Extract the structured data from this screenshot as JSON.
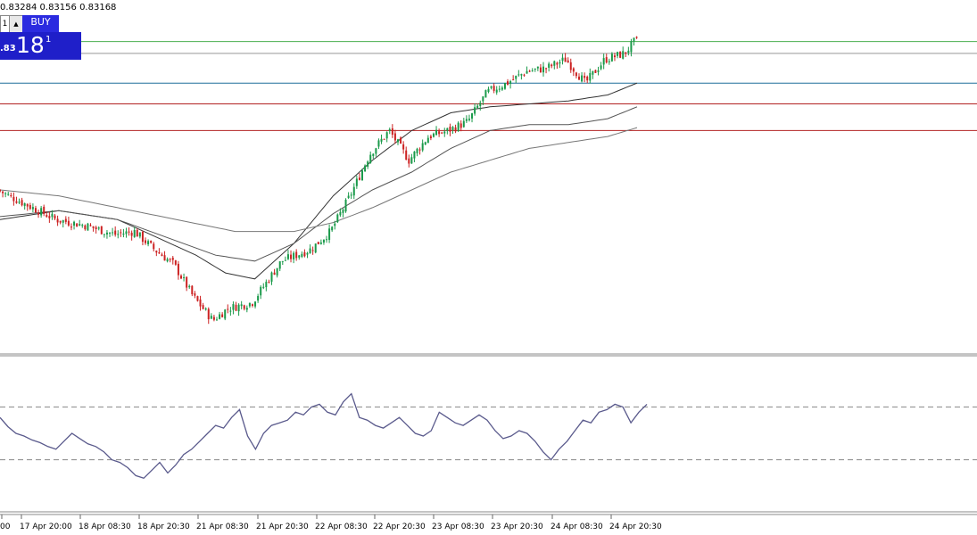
{
  "ohlc_header": "0.83284 0.83156 0.83168",
  "trade_panel": {
    "lot_value": "1",
    "up_arrow": "▲",
    "buy_label": "BUY",
    "price_small": ".83",
    "price_big": "18",
    "price_sup": "1"
  },
  "time_axis": {
    "labels": [
      "00",
      "17 Apr 20:00",
      "18 Apr 08:30",
      "18 Apr 20:30",
      "21 Apr 08:30",
      "21 Apr 20:30",
      "22 Apr 08:30",
      "22 Apr 20:30",
      "23 Apr 08:30",
      "23 Apr 20:30",
      "24 Apr 08:30",
      "24 Apr 20:30"
    ]
  },
  "colors": {
    "bull": "#1a9a4a",
    "bear": "#cc2222",
    "ma": "#444444",
    "oscillator": "#5a5a8c",
    "level_green": "#4caf50",
    "level_blue": "#1f6f9a",
    "level_red": "#b22222"
  },
  "chart_data": {
    "type": "candlestick",
    "symbol_quote": [
      "0.83284",
      "0.83156",
      "0.83168"
    ],
    "close_path": [
      [
        0,
        52
      ],
      [
        3,
        47
      ],
      [
        6,
        42
      ],
      [
        9,
        40
      ],
      [
        12,
        37
      ],
      [
        14,
        38
      ],
      [
        16,
        32
      ],
      [
        18,
        27
      ],
      [
        20,
        16
      ],
      [
        22,
        8
      ],
      [
        23.5,
        12
      ],
      [
        26,
        14
      ],
      [
        29,
        28
      ],
      [
        32,
        32
      ],
      [
        34,
        38
      ],
      [
        36,
        50
      ],
      [
        38,
        64
      ],
      [
        40,
        72
      ],
      [
        42,
        62
      ],
      [
        44,
        70
      ],
      [
        46,
        72
      ],
      [
        48,
        75
      ],
      [
        50,
        85
      ],
      [
        52,
        88
      ],
      [
        54,
        92
      ],
      [
        56,
        93
      ],
      [
        58,
        96
      ],
      [
        60,
        88
      ],
      [
        62,
        96
      ],
      [
        64,
        98
      ],
      [
        65,
        102
      ]
    ],
    "moving_averages": [
      {
        "path": [
          [
            0,
            42
          ],
          [
            6,
            45
          ],
          [
            12,
            42
          ],
          [
            16,
            36
          ],
          [
            20,
            30
          ],
          [
            23,
            24
          ],
          [
            26,
            22
          ],
          [
            30,
            34
          ],
          [
            34,
            50
          ],
          [
            38,
            62
          ],
          [
            42,
            72
          ],
          [
            46,
            78
          ],
          [
            50,
            80
          ],
          [
            54,
            81
          ],
          [
            58,
            82
          ],
          [
            62,
            84
          ],
          [
            65,
            88
          ]
        ]
      },
      {
        "path": [
          [
            0,
            43
          ],
          [
            6,
            45
          ],
          [
            12,
            42
          ],
          [
            17,
            36
          ],
          [
            22,
            30
          ],
          [
            26,
            28
          ],
          [
            30,
            34
          ],
          [
            34,
            44
          ],
          [
            38,
            52
          ],
          [
            42,
            58
          ],
          [
            46,
            66
          ],
          [
            50,
            72
          ],
          [
            54,
            74
          ],
          [
            58,
            74
          ],
          [
            62,
            76
          ],
          [
            65,
            80
          ]
        ]
      },
      {
        "path": [
          [
            0,
            52
          ],
          [
            6,
            50
          ],
          [
            12,
            46
          ],
          [
            18,
            42
          ],
          [
            24,
            38
          ],
          [
            30,
            38
          ],
          [
            34,
            41
          ],
          [
            38,
            46
          ],
          [
            42,
            52
          ],
          [
            46,
            58
          ],
          [
            50,
            62
          ],
          [
            54,
            66
          ],
          [
            58,
            68
          ],
          [
            62,
            70
          ],
          [
            65,
            73
          ]
        ]
      }
    ],
    "horizontal_levels": [
      {
        "value": 102,
        "color": "green"
      },
      {
        "value": 98,
        "color": "gray"
      },
      {
        "value": 88,
        "color": "blue"
      },
      {
        "value": 81,
        "color": "red"
      },
      {
        "value": 72,
        "color": "red"
      }
    ],
    "oscillator": {
      "ylim": [
        0,
        100
      ],
      "levels": [
        70,
        30
      ],
      "values": [
        62,
        55,
        50,
        48,
        45,
        43,
        40,
        38,
        44,
        50,
        46,
        42,
        40,
        36,
        30,
        28,
        24,
        18,
        16,
        22,
        28,
        20,
        26,
        34,
        38,
        44,
        50,
        56,
        54,
        62,
        68,
        48,
        38,
        50,
        56,
        58,
        60,
        66,
        64,
        70,
        72,
        66,
        64,
        74,
        80,
        62,
        60,
        56,
        54,
        58,
        62,
        56,
        50,
        48,
        52,
        66,
        62,
        58,
        56,
        60,
        64,
        60,
        52,
        46,
        48,
        52,
        50,
        44,
        36,
        30,
        38,
        44,
        52,
        60,
        58,
        66,
        68,
        72,
        70,
        58,
        66,
        72
      ]
    },
    "x_range": [
      0,
      66
    ],
    "ylim": [
      0,
      110
    ]
  }
}
